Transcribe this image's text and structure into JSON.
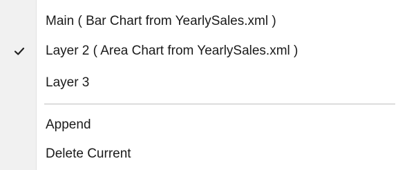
{
  "menu": {
    "items": [
      {
        "label": "Main ( Bar Chart from YearlySales.xml )",
        "checked": false
      },
      {
        "label": "Layer 2 ( Area Chart from YearlySales.xml )",
        "checked": true
      },
      {
        "label": "Layer 3",
        "checked": false
      }
    ],
    "actions": [
      {
        "label": "Append"
      },
      {
        "label": "Delete Current"
      }
    ]
  },
  "icons": {
    "check": "checkmark-icon"
  }
}
